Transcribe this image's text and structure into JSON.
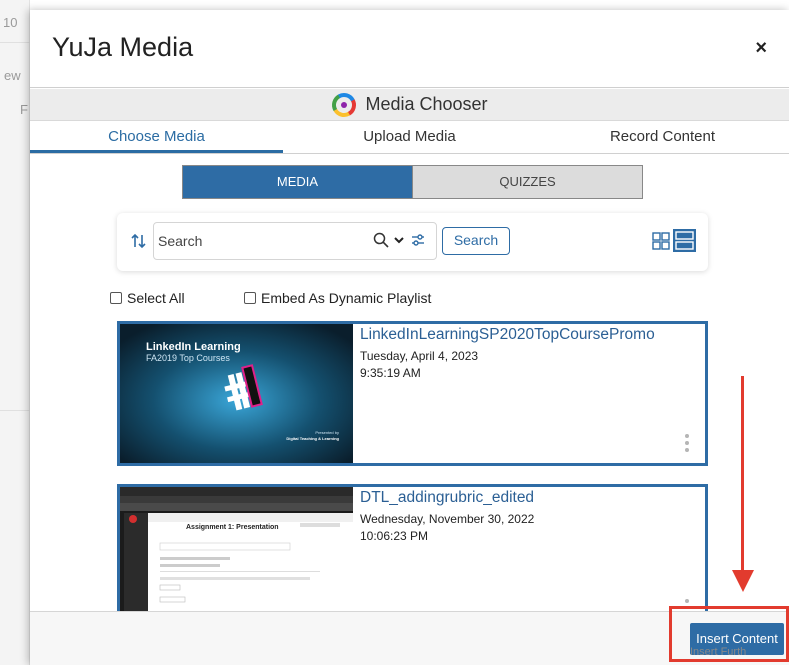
{
  "background": {
    "fragments": [
      "10",
      "ew",
      "F"
    ]
  },
  "modal": {
    "title": "YuJa Media",
    "close_symbol": "×"
  },
  "chooser": {
    "title": "Media Chooser"
  },
  "tabs": [
    {
      "label": "Choose Media",
      "active": true
    },
    {
      "label": "Upload Media",
      "active": false
    },
    {
      "label": "Record Content",
      "active": false
    }
  ],
  "segments": {
    "media": "MEDIA",
    "quizzes": "QUIZZES"
  },
  "search": {
    "placeholder": "Search",
    "button_label": "Search"
  },
  "options": {
    "select_all": "Select All",
    "embed_playlist": "Embed As Dynamic Playlist"
  },
  "media_items": [
    {
      "title": "LinkedInLearningSP2020TopCoursePromo",
      "date": "Tuesday, April 4, 2023",
      "time": "9:35:19 AM",
      "thumbnail": {
        "heading": "LinkedIn Learning",
        "subheading": "FA2019 Top Courses",
        "footer_line1": "Presented by",
        "footer_line2": "Digital Teaching & Learning"
      }
    },
    {
      "title": "DTL_addingrubric_edited",
      "date": "Wednesday, November 30, 2022",
      "time": "10:06:23 PM",
      "thumbnail": {
        "heading": "Assignment 1: Presentation"
      }
    }
  ],
  "footer": {
    "insert_label": "Insert Content",
    "partial_label": "Insert Furth"
  },
  "colors": {
    "accent": "#2e6ca5",
    "annotation": "#e23b2e"
  }
}
